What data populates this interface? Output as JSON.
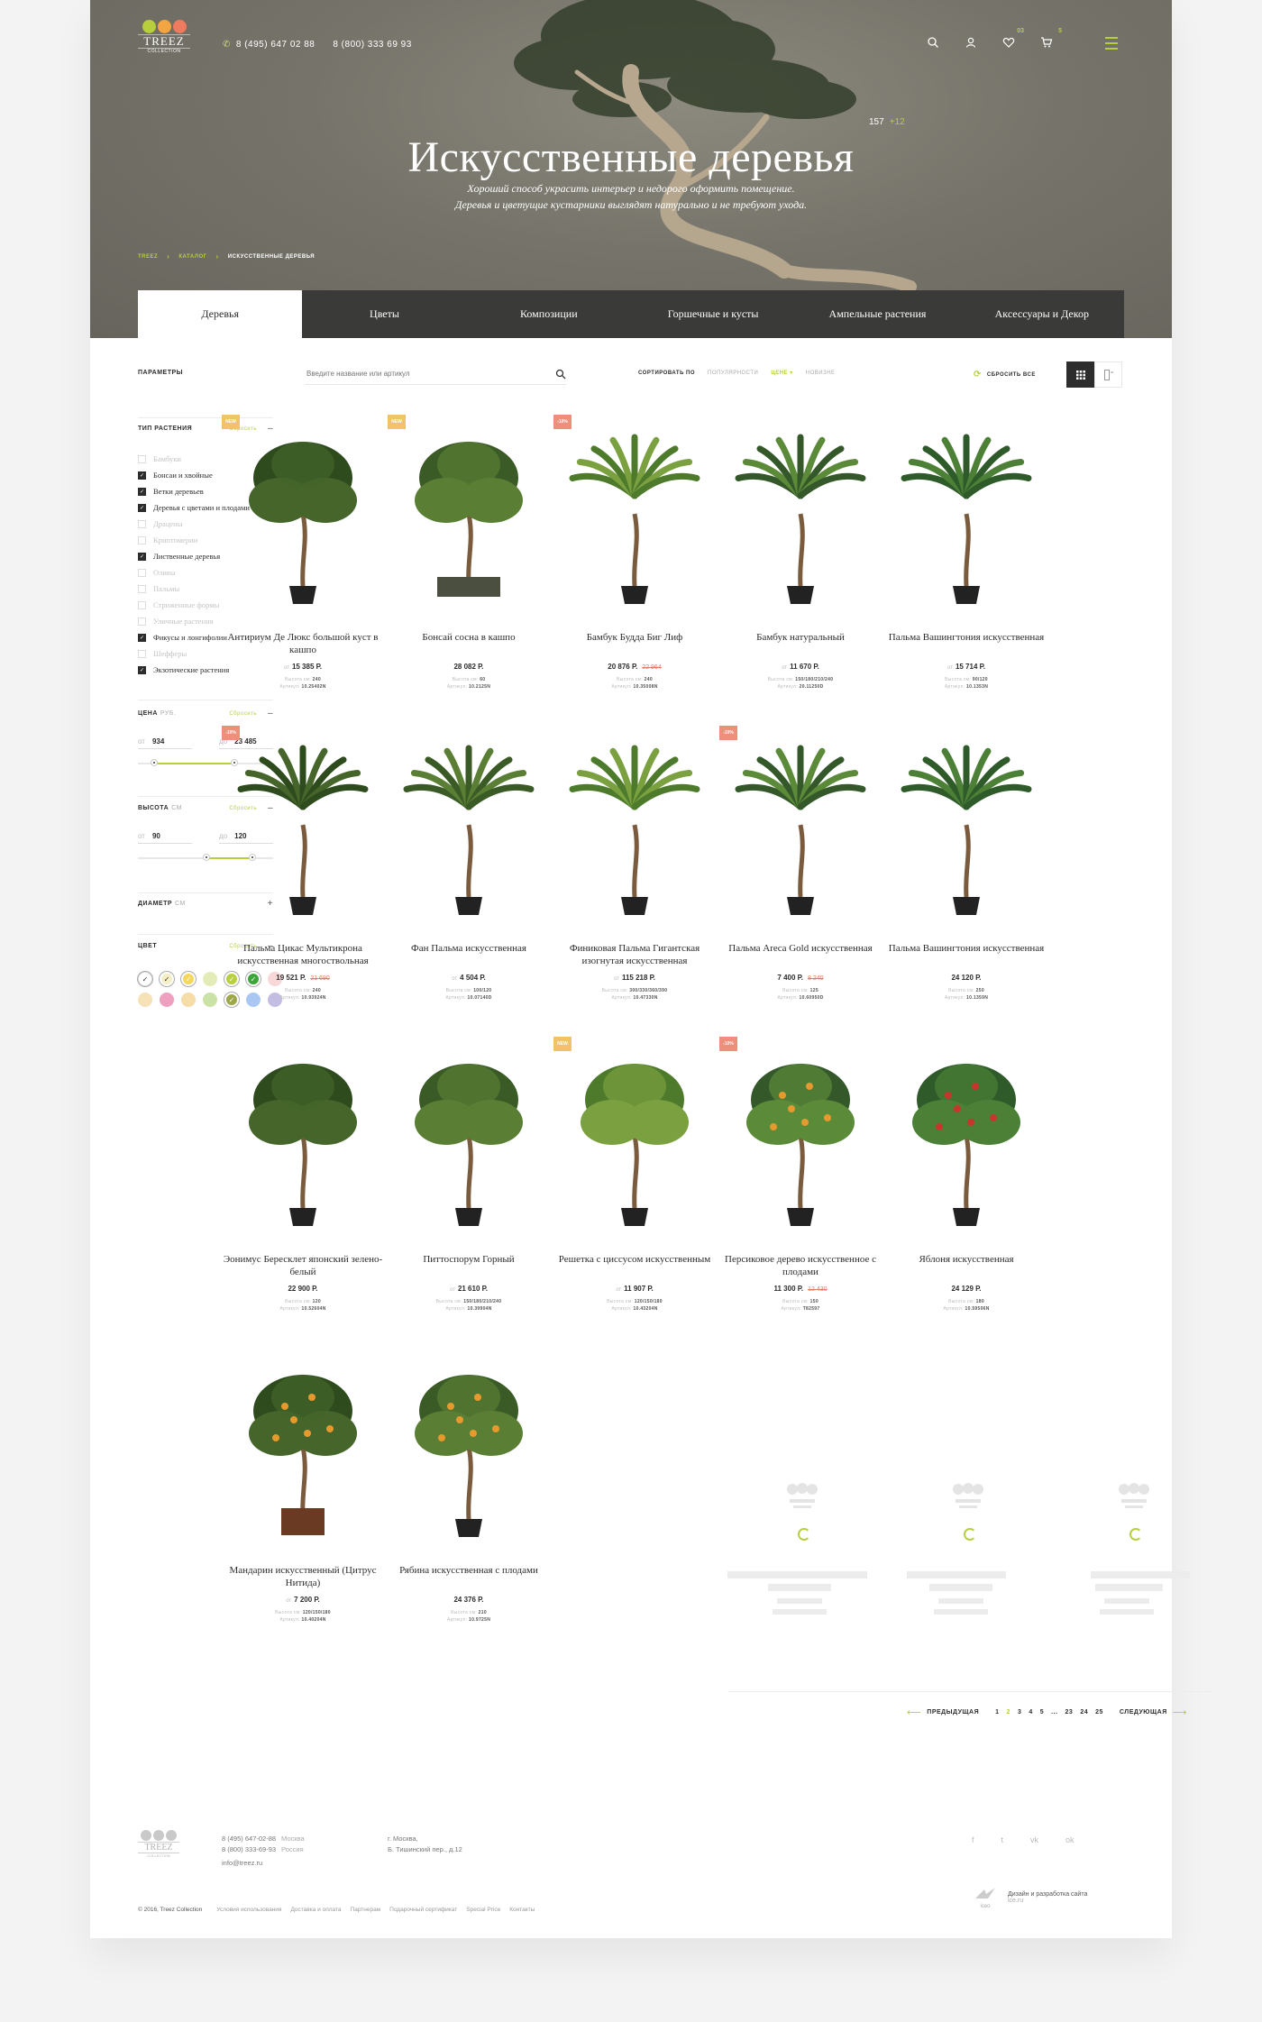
{
  "header": {
    "logo_text": "TREEZ",
    "logo_sub": "COLLECTION",
    "phone1": "8 (495) 647 02 88",
    "phone2": "8 (800) 333 69 93",
    "favorites_count": "03",
    "cart_count": "5"
  },
  "hero": {
    "title": "Искусственные деревья",
    "count": "157",
    "new_count": "+12",
    "desc_line1": "Хороший способ украсить интерьер и недорого оформить помещение.",
    "desc_line2": "Деревья и цветущие кустарники выглядят натурально и не требуют ухода."
  },
  "breadcrumb": [
    "TREEZ",
    "Каталог",
    "Искусственные деревья"
  ],
  "tabs": [
    "Деревья",
    "Цветы",
    "Композиции",
    "Горшечные и кусты",
    "Ампельные растения",
    "Аксессуары и Декор"
  ],
  "filters": {
    "params_label": "Параметры",
    "type": {
      "title": "Тип растения",
      "reset": "Сбросить",
      "items": [
        {
          "label": "Бамбуки",
          "checked": false
        },
        {
          "label": "Бонсаи и хвойные",
          "checked": true
        },
        {
          "label": "Ветки деревьев",
          "checked": true
        },
        {
          "label": "Деревья с цветами и плодами",
          "checked": true
        },
        {
          "label": "Драцены",
          "checked": false
        },
        {
          "label": "Криптомерии",
          "checked": false
        },
        {
          "label": "Лиственные деревья",
          "checked": true
        },
        {
          "label": "Оливы",
          "checked": false
        },
        {
          "label": "Пальмы",
          "checked": false
        },
        {
          "label": "Стриженные формы",
          "checked": false
        },
        {
          "label": "Уличные растения",
          "checked": false
        },
        {
          "label": "Фикусы и лонгифолии",
          "checked": true
        },
        {
          "label": "Шефферы",
          "checked": false
        },
        {
          "label": "Экзотические растения",
          "checked": true
        }
      ]
    },
    "price": {
      "title": "Цена",
      "unit": "руб.",
      "reset": "Сбросить",
      "from_label": "от",
      "to_label": "до",
      "from": "934",
      "to": "23 485"
    },
    "height": {
      "title": "Высота",
      "unit": "см",
      "reset": "Сбросить",
      "from_label": "от",
      "to_label": "до",
      "from": "90",
      "to": "120"
    },
    "diameter": {
      "title": "Диаметр",
      "unit": "см"
    },
    "color": {
      "title": "Цвет",
      "reset": "Сбросить",
      "swatches": [
        "#ffffff",
        "#f6eec7",
        "#f5d75e",
        "#e3ecb6",
        "#b8cf3f",
        "#3ca53a",
        "#f7d7d7",
        "#f7e2b8",
        "#ef9fbf",
        "#f6dca7",
        "#cbe2a7",
        "#9ea64a",
        "#a9c7f2",
        "#c4bde3"
      ],
      "selected": [
        0,
        1,
        2,
        4,
        5,
        11
      ]
    }
  },
  "toolbar": {
    "search_placeholder": "Введите название или артикул",
    "sort_label": "Сортировать по",
    "sort_options": [
      "Популярности",
      "Цене",
      "Новизне"
    ],
    "reset_all": "Сбросить все"
  },
  "products": [
    {
      "tag": "NEW",
      "tag_type": "new",
      "name": "Антириум Де Люкс большой куст в кашпо",
      "from": "от",
      "price": "15 385 Р.",
      "old": "",
      "height_label": "Высота см:",
      "height": "240",
      "art_label": "Артикул:",
      "art": "10.25402N"
    },
    {
      "tag": "NEW",
      "tag_type": "new",
      "name": "Бонсай сосна в кашпо",
      "from": "",
      "price": "28 082 Р.",
      "old": "",
      "height_label": "Высота см:",
      "height": "60",
      "art_label": "Артикул:",
      "art": "10.2125N"
    },
    {
      "tag": "-10%",
      "tag_type": "sale",
      "name": "Бамбук Будда Биг Лиф",
      "from": "",
      "price": "20 876 Р.",
      "old": "22 964",
      "height_label": "Высота см:",
      "height": "240",
      "art_label": "Артикул:",
      "art": "10.35008N"
    },
    {
      "tag": "",
      "tag_type": "",
      "name": "Бамбук натуральный",
      "from": "от",
      "price": "11 670 Р.",
      "old": "",
      "height_label": "Высота см:",
      "height": "150/180/210/240",
      "art_label": "Артикул:",
      "art": "20.11250D"
    },
    {
      "tag": "",
      "tag_type": "",
      "name": "Пальма Вашингтония искусственная",
      "from": "от",
      "price": "15 714 Р.",
      "old": "",
      "height_label": "Высота см:",
      "height": "90/120",
      "art_label": "Артикул:",
      "art": "10.1353N"
    },
    {
      "tag": "-10%",
      "tag_type": "sale",
      "name": "Пальма Цикас Мультикрона искусственная многоствольная",
      "from": "",
      "price": "19 521 Р.",
      "old": "21 690",
      "height_label": "Высота см:",
      "height": "240",
      "art_label": "Артикул:",
      "art": "10.93924N"
    },
    {
      "tag": "",
      "tag_type": "",
      "name": "Фан Пальма искусственная",
      "from": "от",
      "price": "4 504 Р.",
      "old": "",
      "height_label": "Высота см:",
      "height": "100/120",
      "art_label": "Артикул:",
      "art": "10.07140D"
    },
    {
      "tag": "",
      "tag_type": "",
      "name": "Финиковая Пальма Гигантская изогнутая искусственная",
      "from": "от",
      "price": "115 218 Р.",
      "old": "",
      "height_label": "Высота см:",
      "height": "300/330/360/390",
      "art_label": "Артикул:",
      "art": "10.47330N"
    },
    {
      "tag": "-10%",
      "tag_type": "sale",
      "name": "Пальма Areca Gold искусственная",
      "from": "",
      "price": "7 400 Р.",
      "old": "8 240",
      "height_label": "Высота см:",
      "height": "125",
      "art_label": "Артикул:",
      "art": "10.60950D"
    },
    {
      "tag": "",
      "tag_type": "",
      "name": "Пальма Вашингтония искусственная",
      "from": "",
      "price": "24 120 Р.",
      "old": "",
      "height_label": "Высота см:",
      "height": "250",
      "art_label": "Артикул:",
      "art": "10.1359N"
    },
    {
      "tag": "",
      "tag_type": "",
      "name": "Эонимус Бересклет японский зелено-белый",
      "from": "",
      "price": "22 900 Р.",
      "old": "",
      "height_label": "Высота см:",
      "height": "120",
      "art_label": "Артикул:",
      "art": "10.52604N"
    },
    {
      "tag": "",
      "tag_type": "",
      "name": "Питтоспорум Горный",
      "from": "от",
      "price": "21 610 Р.",
      "old": "",
      "height_label": "Высота см:",
      "height": "150/180/210/240",
      "art_label": "Артикул:",
      "art": "10.39904N"
    },
    {
      "tag": "NEW",
      "tag_type": "new",
      "name": "Решетка с циссусом искусственным",
      "from": "от",
      "price": "11 907 Р.",
      "old": "",
      "height_label": "Высота см:",
      "height": "120/150/180",
      "art_label": "Артикул:",
      "art": "10.43204N"
    },
    {
      "tag": "-10%",
      "tag_type": "sale",
      "name": "Персиковое дерево искусственное с плодами",
      "from": "",
      "price": "11 300 Р.",
      "old": "12 430",
      "height_label": "Высота см:",
      "height": "150",
      "art_label": "Артикул:",
      "art": "T82597"
    },
    {
      "tag": "",
      "tag_type": "",
      "name": "Яблоня искусственная",
      "from": "",
      "price": "24 129 Р.",
      "old": "",
      "height_label": "Высота см:",
      "height": "180",
      "art_label": "Артикул:",
      "art": "10.59506N"
    },
    {
      "tag": "",
      "tag_type": "",
      "name": "Мандарин искусственный (Цитрус Нитида)",
      "from": "от",
      "price": "7 200 Р.",
      "old": "",
      "height_label": "Высота см:",
      "height": "120/150/180",
      "art_label": "Артикул:",
      "art": "10.40204N"
    },
    {
      "tag": "",
      "tag_type": "",
      "name": "Рябина искусственная с плодами",
      "from": "",
      "price": "24 376 Р.",
      "old": "",
      "height_label": "Высота см:",
      "height": "210",
      "art_label": "Артикул:",
      "art": "10.9725N"
    }
  ],
  "pagination": {
    "prev": "Предыдущая",
    "next": "Следующая",
    "pages": [
      "1",
      "2",
      "3",
      "4",
      "5",
      "...",
      "23",
      "24",
      "25"
    ],
    "active": "2"
  },
  "footer": {
    "phone1": "8 (495) 647-02-88",
    "phone1_city": "Москва",
    "phone2": "8 (800) 333-69-93",
    "phone2_city": "Россия",
    "email": "info@treez.ru",
    "address1": "г. Москва,",
    "address2": "Б. Тишинский пер., д.12",
    "copyright": "© 2016, Treez Collection",
    "links": [
      "Условия использования",
      "Доставка и оплата",
      "Партнерам",
      "Подарочный сертификат",
      "Special Price",
      "Контакты"
    ],
    "socials": [
      "f",
      "t",
      "vk",
      "ok"
    ],
    "dev_logo": "iceo",
    "dev_title": "Дизайн и разработка сайта",
    "dev_site": "ice.ru"
  },
  "colors": {
    "accent": "#b7cf3b",
    "dark": "#2d2d2d",
    "sale": "#ef8f7b",
    "new": "#f0c36b"
  }
}
